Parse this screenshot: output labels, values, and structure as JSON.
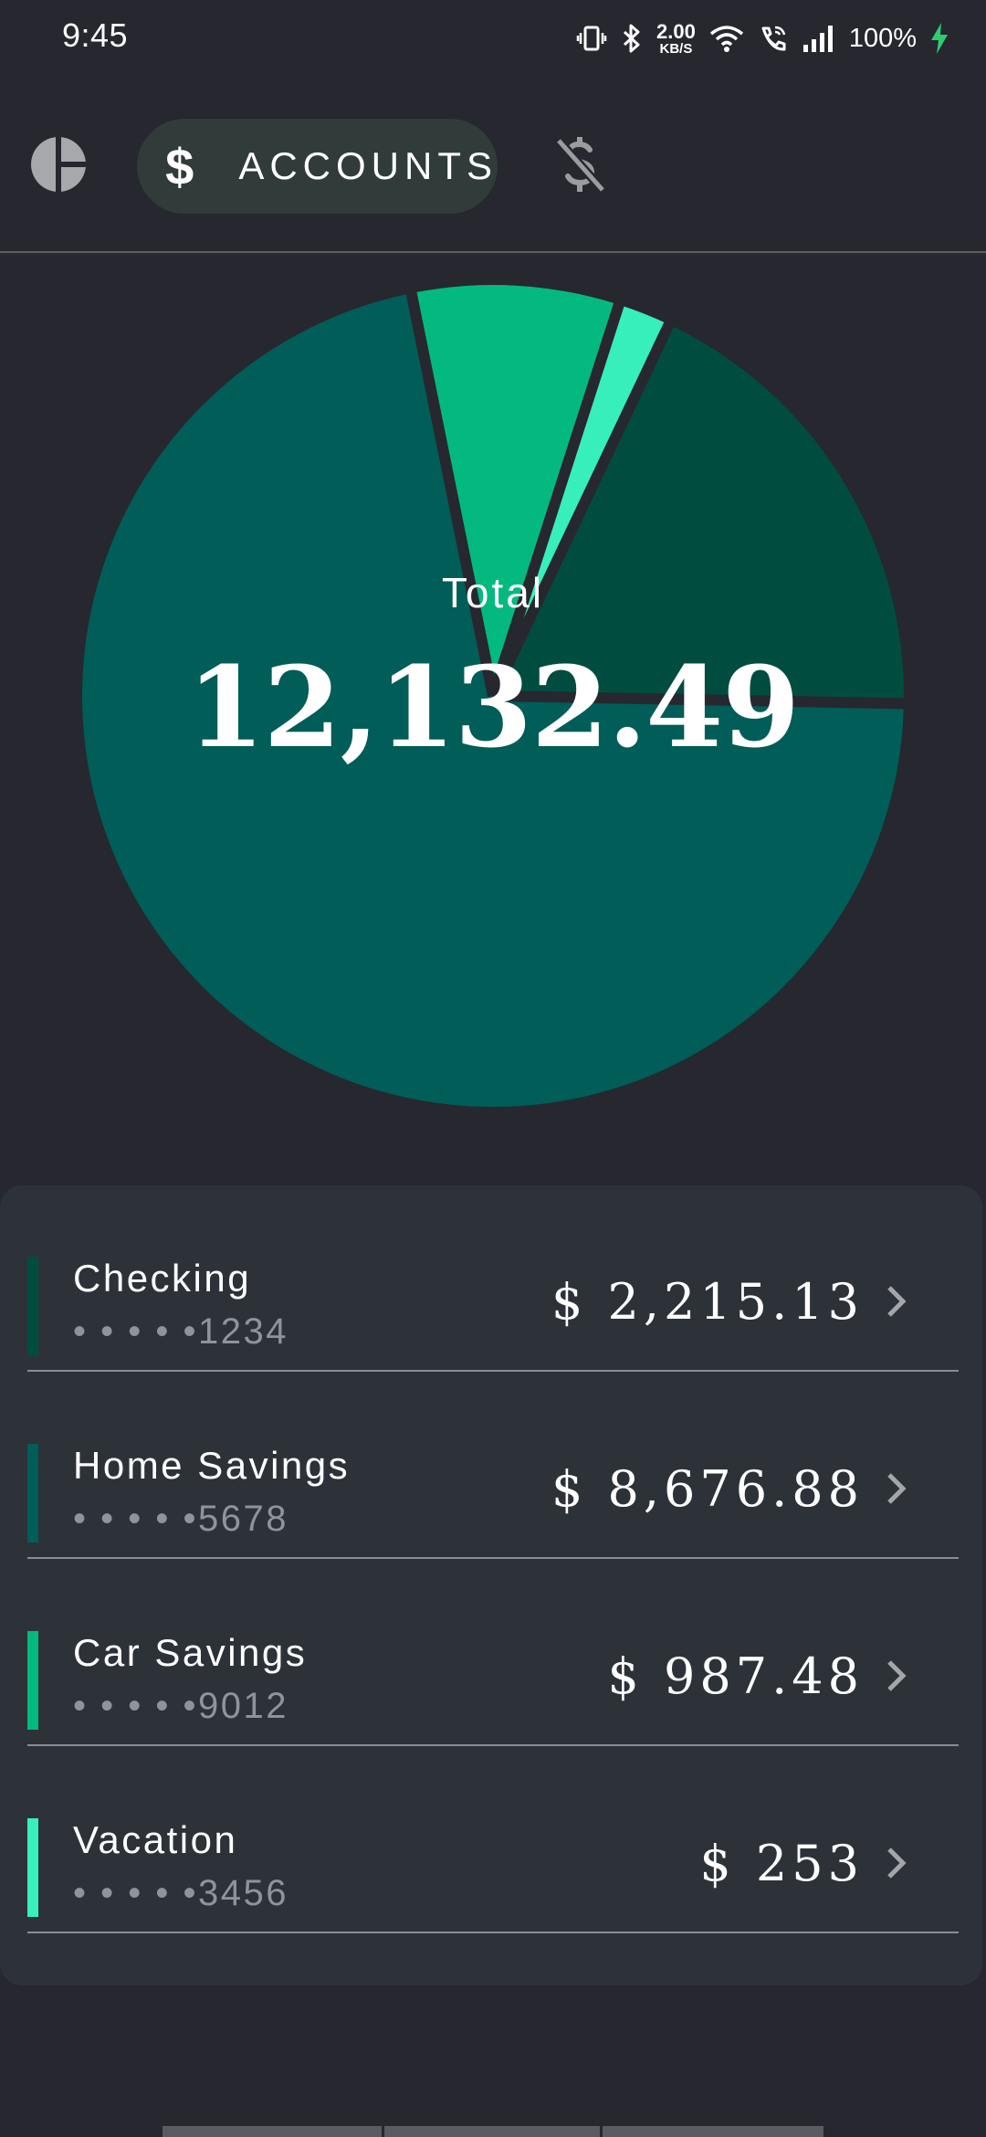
{
  "status_bar": {
    "time": "9:45",
    "net_speed_value": "2.00",
    "net_speed_unit": "KB/S",
    "battery_percent": "100%",
    "icons": [
      "vibrate-icon",
      "bluetooth-icon",
      "wifi-icon",
      "wifi-calling-icon",
      "signal-icon",
      "battery-charging-icon"
    ]
  },
  "tabs": {
    "overview_icon": "pie-chart-icon",
    "accounts_symbol": "$",
    "accounts_label": "ACCOUNTS",
    "bills_icon": "no-money-icon",
    "selected": "accounts"
  },
  "summary": {
    "total_label": "Total",
    "total_value": "12,132.49"
  },
  "chart_data": {
    "type": "pie",
    "title": "",
    "center_label": "Total",
    "center_value": "12,132.49",
    "categories": [
      "Checking",
      "Home Savings",
      "Car Savings",
      "Vacation"
    ],
    "values": [
      2215.13,
      8676.88,
      987.48,
      253
    ],
    "colors": [
      "#004d40",
      "#005d57",
      "#04b97f",
      "#37efba"
    ],
    "exploded": true
  },
  "accounts": [
    {
      "name": "Checking",
      "masked_number": "• • • • •1234",
      "amount": "$ 2,215.13",
      "color": "#004d40"
    },
    {
      "name": "Home Savings",
      "masked_number": "• • • • •5678",
      "amount": "$ 8,676.88",
      "color": "#005d57"
    },
    {
      "name": "Car Savings",
      "masked_number": "• • • • •9012",
      "amount": "$ 987.48",
      "color": "#04b97f"
    },
    {
      "name": "Vacation",
      "masked_number": "• • • • •3456",
      "amount": "$ 253",
      "color": "#37efba"
    }
  ],
  "colors": {
    "background": "#26272f",
    "card": "#2d3239",
    "selected_tab": "#303b3a",
    "muted_text": "#8f949a",
    "charging_green": "#2ecc71"
  }
}
